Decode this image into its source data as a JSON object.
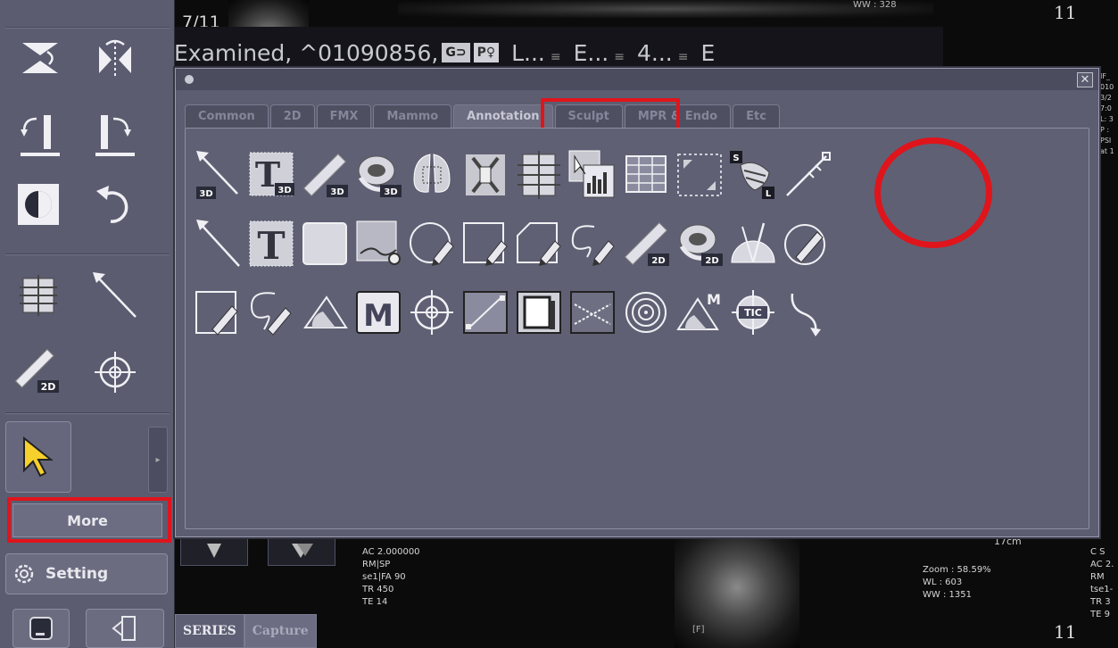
{
  "viewer": {
    "frame_counter": "7/11",
    "series_header": {
      "title": "Examined, ^01090856,",
      "chip_1": "G⊃",
      "chip_2": "P♀",
      "dd_1": "L...",
      "dd_2": "E...",
      "dd_3": "4...",
      "dd_4": "E",
      "lines_glyph": "≡"
    },
    "top_eleven": "11",
    "bottom_eleven": "11",
    "scale_label": "17cm",
    "f_mark": "[F]",
    "bottom_left_info": [
      "AC 2.000000",
      "RM|SP",
      "se1|FA 90",
      "TR 450",
      "TE 14"
    ],
    "bottom_right_info": [
      "Zoom : 58.59%",
      "WL : 603",
      "WW : 1351"
    ],
    "far_right_info": [
      "C S",
      "AC 2.",
      "RM",
      "tse1-",
      "TR 3",
      "TE 9"
    ],
    "right_strip_info": [
      "IF_",
      "010",
      "3/2",
      "7:0",
      "",
      "L: 3",
      "P :",
      "PSI",
      "at 1"
    ]
  },
  "left_panel": {
    "more_label": "More",
    "setting_label": "Setting",
    "expand_glyph": "▸",
    "series_tabs": [
      {
        "label": "SERIES",
        "active": true
      },
      {
        "label": "Capture",
        "active": false
      }
    ]
  },
  "dialog": {
    "close_glyph": "✕",
    "tabs": [
      {
        "label": "Common",
        "active": false
      },
      {
        "label": "2D",
        "active": false
      },
      {
        "label": "FMX",
        "active": false
      },
      {
        "label": "Mammo",
        "active": false
      },
      {
        "label": "Annotation",
        "active": true
      },
      {
        "label": "Sculpt",
        "active": false
      },
      {
        "label": "MPR & Endo",
        "active": false
      },
      {
        "label": "Etc",
        "active": false
      }
    ],
    "tool_rows": [
      [
        "line-3d-icon",
        "text-3d-icon",
        "ruler-3d-icon",
        "tape-3d-icon",
        "lung-roi-icon",
        "spine-roi-icon",
        "spine-grid-icon",
        "volume-chart-icon",
        "table-grid-icon",
        "dotted-box-icon",
        "spine-label-sl-icon",
        "angled-ruler-icon"
      ],
      [
        "line-icon",
        "text-icon",
        "rectangle-fill-icon",
        "histogram-icon",
        "circle-pen-icon",
        "square-pen-icon",
        "polygon-pen-icon",
        "freehand-pen-icon",
        "ruler-2d-icon",
        "tape-2d-icon",
        "protractor-icon",
        "ellipse-edit-icon"
      ],
      [
        "square-edit-icon",
        "freehand-edit-icon",
        "angle-icon",
        "m-marker-icon",
        "crosshair-icon",
        "diagonal-box-icon",
        "frame-image-icon",
        "cobb-angle-icon",
        "concentric-circles-icon",
        "angle-m-icon",
        "tic-target-icon",
        "curve-arrow-icon"
      ]
    ],
    "tool_text": {
      "badge_3d": "3D",
      "badge_2d": "2D",
      "glyph_t": "T",
      "glyph_m": "M",
      "badge_m": "M",
      "glyph_tic": "TIC",
      "badge_s": "S",
      "badge_l": "L"
    }
  },
  "colors": {
    "highlight": "#e0141b",
    "panel": "#5b5c70",
    "dialog": "#5c5d70",
    "tab_active_text": "#c7c7d4"
  }
}
